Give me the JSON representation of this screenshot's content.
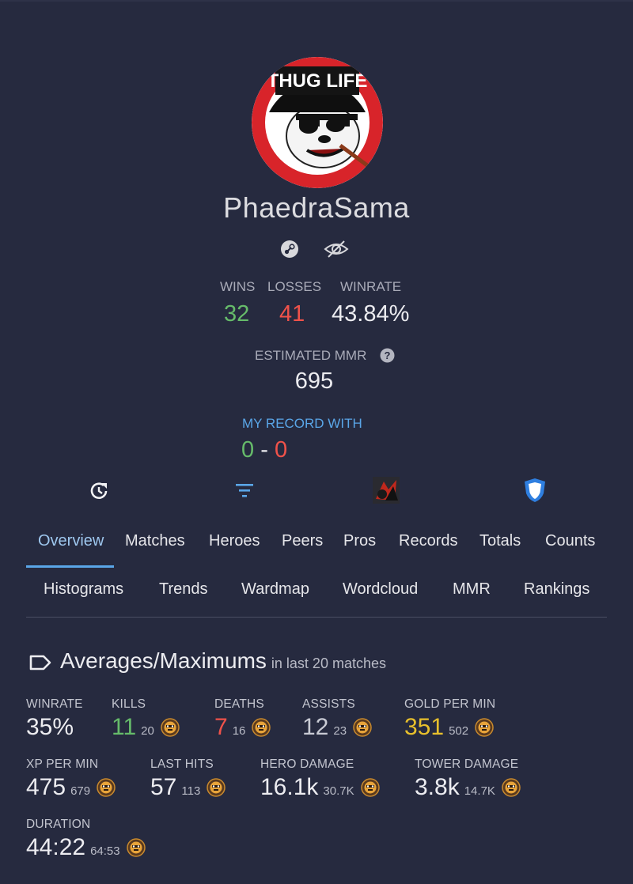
{
  "profile": {
    "name": "PhaedraSama",
    "avatar_text": "THUG LIFE"
  },
  "record": {
    "wins_label": "WINS",
    "losses_label": "LOSSES",
    "winrate_label": "WINRATE",
    "wins": "32",
    "losses": "41",
    "winrate": "43.84%"
  },
  "mmr": {
    "label": "ESTIMATED MMR",
    "value": "695"
  },
  "my_record": {
    "label": "MY RECORD WITH",
    "wins": "0",
    "separator": "-",
    "losses": "0"
  },
  "tabs_row1": [
    "Overview",
    "Matches",
    "Heroes",
    "Peers",
    "Pros",
    "Records",
    "Totals",
    "Counts"
  ],
  "tabs_row2": [
    "Histograms",
    "Trends",
    "Wardmap",
    "Wordcloud",
    "MMR",
    "Rankings"
  ],
  "section": {
    "title": "Averages/Maximums",
    "subtitle": "in last 20 matches"
  },
  "averages": {
    "winrate": {
      "label": "WINRATE",
      "value": "35%"
    },
    "kills": {
      "label": "KILLS",
      "value": "11",
      "max": "20"
    },
    "deaths": {
      "label": "DEATHS",
      "value": "7",
      "max": "16"
    },
    "assists": {
      "label": "ASSISTS",
      "value": "12",
      "max": "23"
    },
    "gpm": {
      "label": "GOLD PER MIN",
      "value": "351",
      "max": "502"
    },
    "xpm": {
      "label": "XP PER MIN",
      "value": "475",
      "max": "679"
    },
    "last_hits": {
      "label": "LAST HITS",
      "value": "57",
      "max": "113"
    },
    "hero_damage": {
      "label": "HERO DAMAGE",
      "value": "16.1k",
      "max": "30.7K"
    },
    "tower_damage": {
      "label": "TOWER DAMAGE",
      "value": "3.8k",
      "max": "14.7K"
    },
    "duration": {
      "label": "DURATION",
      "value": "44:22",
      "max": "64:53"
    }
  },
  "colors": {
    "background": "#262a3f",
    "win": "#66bb6a",
    "loss": "#f0524a",
    "accent": "#5aa6e8",
    "gold": "#e8c02c"
  },
  "icons": [
    "steam-icon",
    "hidden-eye-icon",
    "recent-history-icon",
    "filter-icon",
    "dota-hero-icon",
    "shield-icon",
    "tag-icon",
    "hero-medal-icon"
  ]
}
